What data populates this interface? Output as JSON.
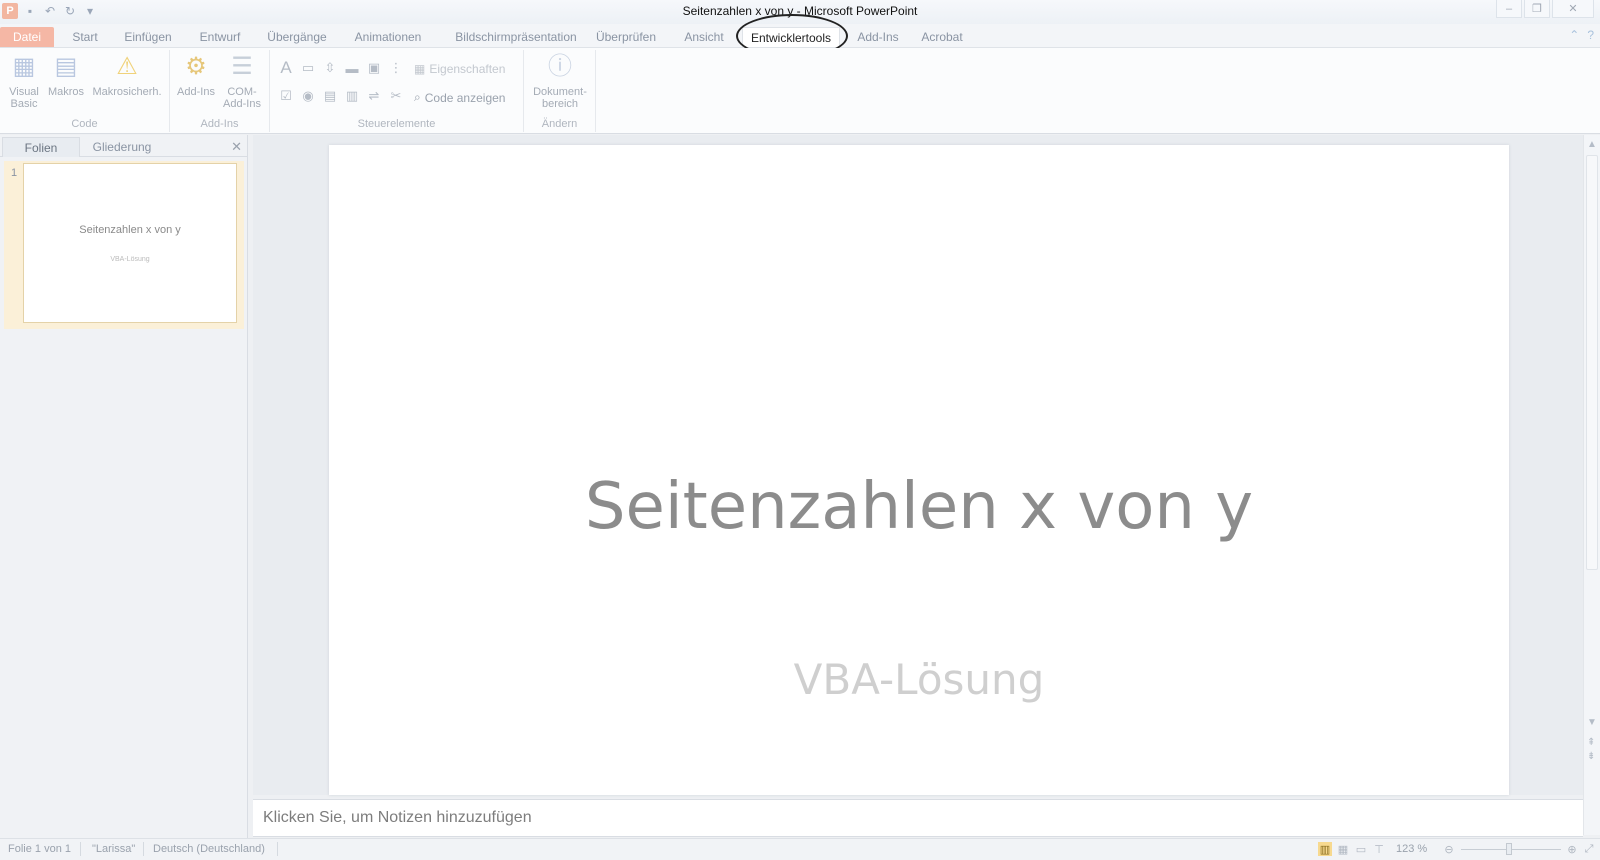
{
  "window": {
    "title_dim": "Seitenzahlen x von y",
    "title_suffix": " - Microsoft PowerPoint",
    "controls": [
      "minimize-icon",
      "restore-icon",
      "close-icon"
    ]
  },
  "quick_access": {
    "app_icon_letter": "P",
    "icons": [
      "save-icon",
      "undo-icon",
      "redo-icon",
      "customize-icon"
    ]
  },
  "tabs": [
    {
      "label": "Datei"
    },
    {
      "label": "Start"
    },
    {
      "label": "Einfügen"
    },
    {
      "label": "Entwurf"
    },
    {
      "label": "Übergänge"
    },
    {
      "label": "Animationen"
    },
    {
      "label": "Bildschirmpräsentation"
    },
    {
      "label": "Überprüfen"
    },
    {
      "label": "Ansicht"
    },
    {
      "label": "Entwicklertools"
    },
    {
      "label": "Add-Ins"
    },
    {
      "label": "Acrobat"
    }
  ],
  "active_tab": "Entwicklertools",
  "ribbon": {
    "code": {
      "label": "Code",
      "visual_basic_1": "Visual",
      "visual_basic_2": "Basic",
      "makros": "Makros",
      "makrosicherheit": "Makrosicherh."
    },
    "addins": {
      "label": "Add-Ins",
      "add_ins": "Add-Ins",
      "com_1": "COM-",
      "com_2": "Add-Ins"
    },
    "controls": {
      "label": "Steuerelemente",
      "eigenschaften": "Eigenschaften",
      "code_anzeigen": "Code anzeigen"
    },
    "aendern": {
      "label": "Ändern",
      "dokument_1": "Dokument-",
      "dokument_2": "bereich"
    }
  },
  "left_pane": {
    "tab_folien": "Folien",
    "tab_gliederung": "Gliederung",
    "slide_number": "1",
    "thumb_title": "Seitenzahlen x von y",
    "thumb_subtitle": "VBA-Lösung"
  },
  "slide": {
    "title": "Seitenzahlen x von y",
    "subtitle": "VBA-Lösung"
  },
  "notes": {
    "placeholder": "Klicken Sie, um Notizen hinzuzufügen"
  },
  "status": {
    "slide_info": "Folie 1 von 1",
    "theme": "\"Larissa\"",
    "language": "Deutsch (Deutschland)",
    "zoom": "123 %"
  }
}
